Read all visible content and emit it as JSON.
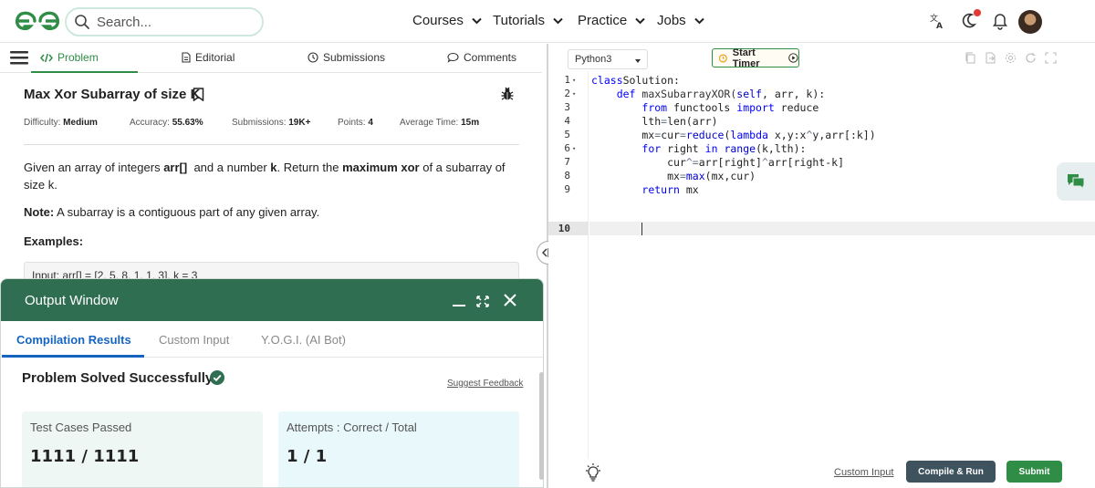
{
  "nav": {
    "search_placeholder": "Search...",
    "menus": [
      "Courses",
      "Tutorials",
      "Practice",
      "Jobs"
    ]
  },
  "problem_tabs": {
    "problem": "Problem",
    "editorial": "Editorial",
    "submissions": "Submissions",
    "comments": "Comments"
  },
  "problem": {
    "title": "Max Xor Subarray of size K",
    "difficulty_label": "Difficulty:",
    "difficulty": "Medium",
    "accuracy_label": "Accuracy:",
    "accuracy": "55.63%",
    "submissions_label": "Submissions:",
    "submissions": "19K+",
    "points_label": "Points:",
    "points": "4",
    "avg_time_label": "Average Time:",
    "avg_time": "15m",
    "desc_1": "Given an array of integers ",
    "desc_arr": "arr[]",
    "desc_2": "  and a number ",
    "desc_k": "k",
    "desc_3": ". Return the ",
    "desc_max": "maximum xor",
    "desc_4": " of a subarray of size k.",
    "note_label": "Note:",
    "note_text": " A subarray is a contiguous part of any given array.",
    "examples_label": "Examples:",
    "example_partial": "Input: arr[] = [2, 5, 8, 1, 1, 3], k = 3"
  },
  "output_window": {
    "title": "Output Window",
    "tabs": [
      "Compilation Results",
      "Custom Input",
      "Y.O.G.I. (AI Bot)"
    ],
    "status": "Problem Solved Successfully",
    "suggest_feedback": "Suggest Feedback",
    "tests_label": "Test Cases Passed",
    "tests_value": "1111 / 1111",
    "attempts_label": "Attempts : Correct / Total",
    "attempts_value": "1 / 1"
  },
  "editor": {
    "language": "Python3",
    "start_timer": "Start Timer",
    "line_numbers": [
      "1",
      "2",
      "3",
      "4",
      "5",
      "6",
      "7",
      "8",
      "9",
      "10"
    ],
    "custom_input": "Custom Input",
    "compile_run": "Compile & Run",
    "submit": "Submit"
  },
  "colors": {
    "brand_green": "#2f8d46",
    "output_header": "#2f6e51",
    "active_tab_blue": "#1565c0",
    "run_button": "#3f535f"
  }
}
